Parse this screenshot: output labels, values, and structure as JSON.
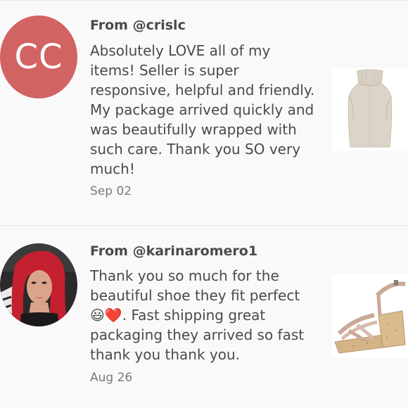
{
  "reviews": [
    {
      "from": "From @crislc",
      "avatar_initials": "CC",
      "text": "Absolutely LOVE all of my items! Seller is super responsive, helpful and friendly. My package arrived quickly and was beautifully wrapped with such care. Thank you SO very much!",
      "date": "Sep 02",
      "item": "sleeveless-knit-turtleneck-top"
    },
    {
      "from": "From @karinaromero1",
      "text_part1": "Thank you so much for the beautiful shoe they fit perfect ",
      "emoji_1": "😃",
      "emoji_2": "❤️",
      "text_part2": ". Fast shipping great packaging they arrived so fast thank you thank you.",
      "date": "Aug 26",
      "item": "cork-platform-strappy-sandal"
    }
  ],
  "colors": {
    "avatar_bg": "#d26363",
    "text": "#4a4a4a",
    "date": "#7a7a7a",
    "divider": "#e6e3e3"
  }
}
